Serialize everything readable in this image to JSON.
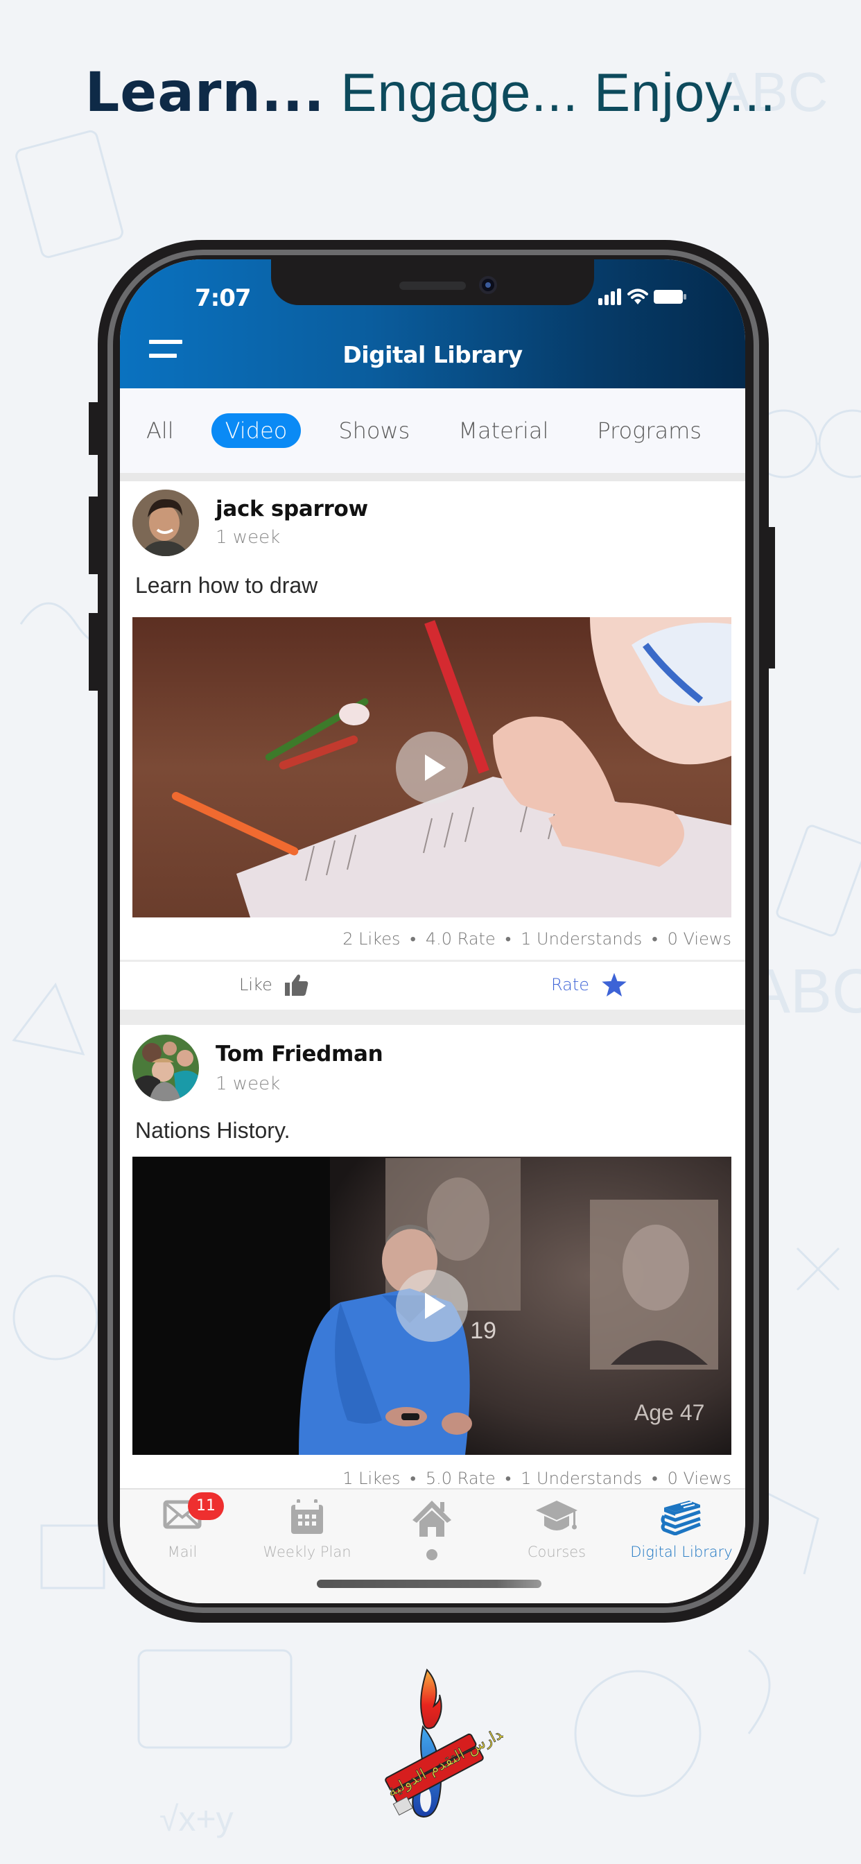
{
  "headline": {
    "bold": "Learn...",
    "rest": " Engage... Enjoy..."
  },
  "status_bar": {
    "time": "7:07",
    "icons": [
      "signal-icon",
      "wifi-icon",
      "battery-icon"
    ]
  },
  "app_bar": {
    "title": "Digital Library",
    "menu_icon": "hamburger-menu-icon"
  },
  "filter_tabs": [
    {
      "label": "All",
      "active": false
    },
    {
      "label": "Video",
      "active": true
    },
    {
      "label": "Shows",
      "active": false
    },
    {
      "label": "Material",
      "active": false
    },
    {
      "label": "Programs",
      "active": false
    }
  ],
  "posts": [
    {
      "author": "jack sparrow",
      "time": "1 week",
      "title": "Learn how to draw",
      "media_type": "video",
      "stats": {
        "likes": "2 Likes",
        "rate": "4.0 Rate",
        "understands": "1 Understands",
        "views": "0 Views"
      },
      "actions": {
        "like_label": "Like",
        "rate_label": "Rate"
      }
    },
    {
      "author": "Tom Friedman",
      "time": "1 week",
      "title": "Nations History.",
      "media_type": "video",
      "media_caption_1": "ge 19",
      "media_caption_2": "Age 47",
      "stats": {
        "likes": "1 Likes",
        "rate": "5.0 Rate",
        "understands": "1 Understands",
        "views": "0 Views"
      }
    }
  ],
  "bottom_nav": [
    {
      "label": "Mail",
      "icon": "mail-icon",
      "badge": "11",
      "active": false
    },
    {
      "label": "Weekly Plan",
      "icon": "calendar-icon",
      "active": false
    },
    {
      "label": "",
      "icon": "home-icon",
      "active": false
    },
    {
      "label": "Courses",
      "icon": "graduation-cap-icon",
      "active": false
    },
    {
      "label": "Digital Library",
      "icon": "books-icon",
      "active": true
    }
  ],
  "colors": {
    "accent": "#0a8af5",
    "appbar_start": "#0a72c0",
    "appbar_end": "#042a4d",
    "rate_blue": "#3d63d6",
    "badge_red": "#ee2f2f",
    "nav_active": "#1c75c2"
  },
  "logo": {
    "name": "school-logo",
    "text": "مدارس التقدم الدولية"
  }
}
